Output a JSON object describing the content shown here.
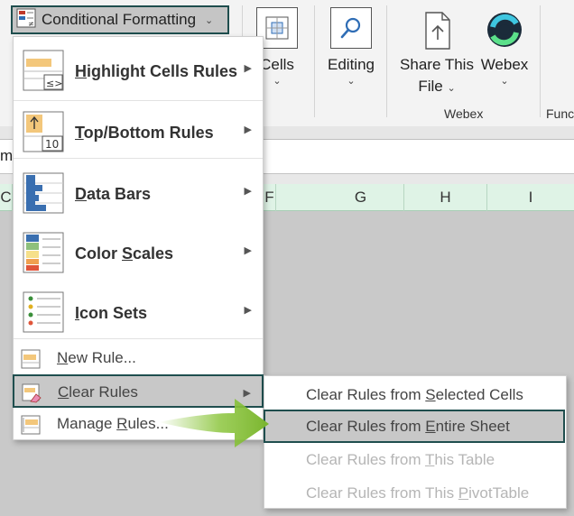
{
  "ribbon": {
    "conditional_formatting": {
      "label": "Conditional Formatting",
      "icon": "conditional-formatting-icon"
    },
    "cells": {
      "label": "Cells",
      "icon": "cells-icon"
    },
    "editing": {
      "label": "Editing",
      "icon": "search-icon"
    },
    "share_this_file": {
      "label_line1": "Share This",
      "label_line2": "File",
      "icon": "share-file-icon"
    },
    "webex": {
      "label": "Webex",
      "icon": "webex-icon"
    },
    "groups": {
      "webex": "Webex",
      "next_partial": "Func"
    }
  },
  "sheet": {
    "namebox_partial": "m",
    "columns": [
      "C",
      "F",
      "G",
      "H",
      "I"
    ]
  },
  "menu": {
    "items_big": [
      {
        "label_pre": "",
        "label_u": "H",
        "label_post": "ighlight Cells Rules",
        "icon": "highlight-cells-rules-icon",
        "badge": "≤>"
      },
      {
        "label_pre": "",
        "label_u": "T",
        "label_post": "op/Bottom Rules",
        "icon": "top-bottom-rules-icon",
        "badge": "10"
      },
      {
        "label_pre": "",
        "label_u": "D",
        "label_post": "ata Bars",
        "icon": "data-bars-icon"
      },
      {
        "label_pre": "Color ",
        "label_u": "S",
        "label_post": "cales",
        "icon": "color-scales-icon"
      },
      {
        "label_pre": "",
        "label_u": "I",
        "label_post": "con Sets",
        "icon": "icon-sets-icon"
      }
    ],
    "items_small": [
      {
        "label_pre": "",
        "label_u": "N",
        "label_post": "ew Rule...",
        "icon": "new-rule-icon"
      },
      {
        "label_pre": "",
        "label_u": "C",
        "label_post": "lear Rules",
        "icon": "clear-rules-icon",
        "has_submenu": true
      },
      {
        "label_pre": "Manage ",
        "label_u": "R",
        "label_post": "ules...",
        "icon": "manage-rules-icon"
      }
    ]
  },
  "submenu": {
    "items": [
      {
        "label_pre": "Clear Rules from ",
        "label_u": "S",
        "label_post": "elected Cells",
        "enabled": true
      },
      {
        "label_pre": "Clear Rules from ",
        "label_u": "E",
        "label_post": "ntire Sheet",
        "enabled": true
      },
      {
        "label_pre": "Clear Rules from ",
        "label_u": "T",
        "label_post": "his Table",
        "enabled": false
      },
      {
        "label_pre": "Clear Rules from This ",
        "label_u": "P",
        "label_post": "ivotTable",
        "enabled": false
      }
    ]
  },
  "colors": {
    "selection_border": "#1f4e4e",
    "pointer_arrow": "#8dc63f",
    "column_header_bg": "#dff3e6"
  }
}
